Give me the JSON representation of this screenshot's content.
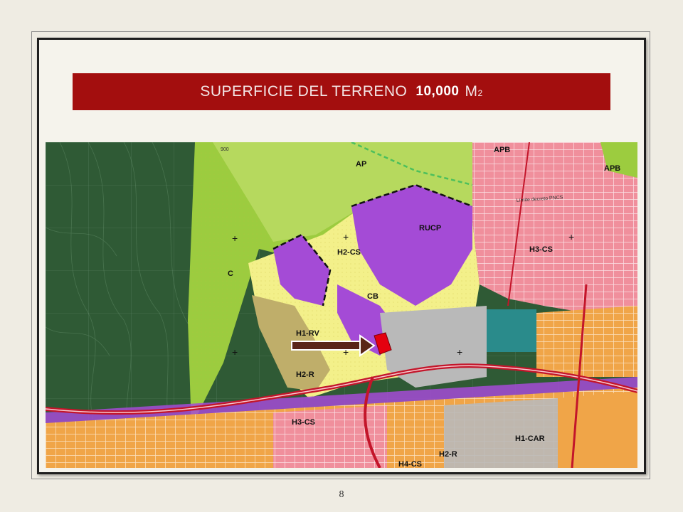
{
  "banner": {
    "label": "SUPERFICIE  DEL  TERRENO",
    "area_value": "10,000",
    "area_unit": "M",
    "area_unit_superscript": "2"
  },
  "map": {
    "zone_labels": {
      "ap": "AP",
      "apb_top": "APB",
      "apb_right": "APB",
      "rucp": "RUCP",
      "h2cs": "H2-CS",
      "c": "C",
      "h1rv": "H1-RV",
      "h2r_left": "H2-R",
      "h3cs_right": "H3-CS",
      "h3cs_bottom": "H3-CS",
      "h1car": "H1-CAR",
      "h2r_bottom": "H2-R",
      "h4cs": "H4-CS",
      "cb": "CB",
      "limite": "Límite decreto PNCS",
      "contour_900": "900"
    },
    "colors": {
      "forest": "#2f5a35",
      "conservation_green": "#9ccc3f",
      "residential_yellow": "#f3f08a",
      "purple_zone": "#a44bd6",
      "urban_pink": "#f08f9c",
      "commercial_grey": "#b9b9b9",
      "orange_zone": "#f0a548",
      "road_red": "#c3152a",
      "highlight_parcel": "#e4000f",
      "arrow": "#5a2618"
    }
  },
  "page_number": "8"
}
